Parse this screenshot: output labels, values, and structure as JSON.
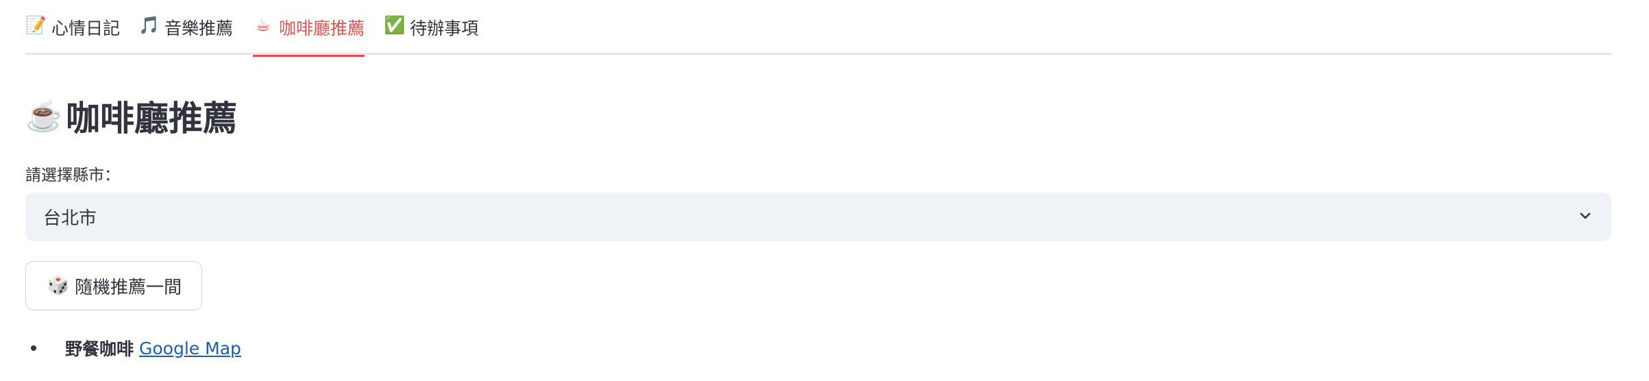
{
  "tabs": [
    {
      "icon": "📝",
      "icon_name": "memo-icon",
      "label": "心情日記",
      "active": false
    },
    {
      "icon": "🎵",
      "icon_name": "music-note-icon",
      "label": "音樂推薦",
      "active": false
    },
    {
      "icon": "☕",
      "icon_name": "coffee-icon",
      "label": "咖啡廳推薦",
      "active": true
    },
    {
      "icon": "✅",
      "icon_name": "check-mark-icon",
      "label": "待辦事項",
      "active": false
    }
  ],
  "header": {
    "icon": "☕",
    "title": "咖啡廳推薦"
  },
  "city_select": {
    "label": "請選擇縣市：",
    "value": "台北市"
  },
  "random_button": {
    "icon": "🎲",
    "label": "隨機推薦一間"
  },
  "result": {
    "name": "野餐咖啡",
    "link_text": "Google Map"
  },
  "colors": {
    "active_tab": "#d9534f",
    "link": "#1c5ea8",
    "select_bg": "#eff2f6",
    "text": "#31333f"
  }
}
